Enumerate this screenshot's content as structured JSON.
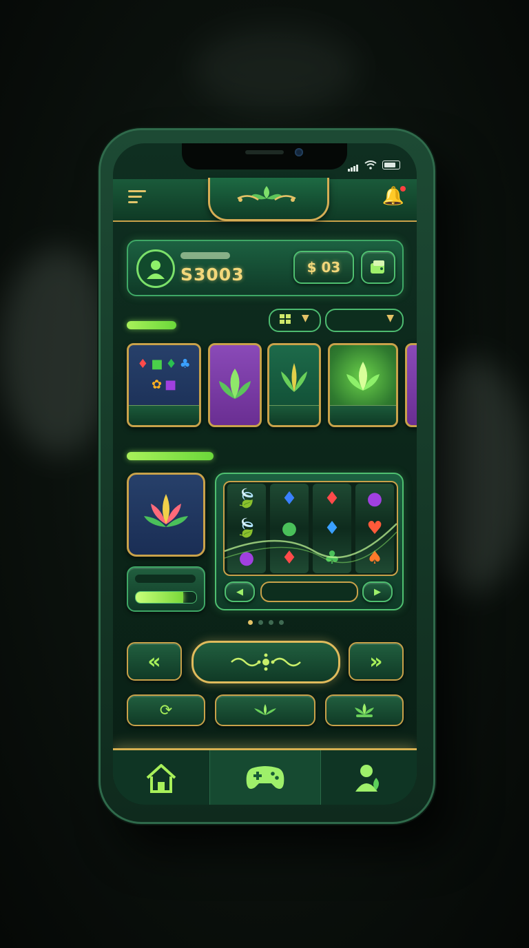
{
  "balance_panel": {
    "amount": "S3003",
    "coins": "$ 03"
  },
  "colors": {
    "accent": "#a8f05a",
    "gold": "#c9a24a",
    "panel": "#1c6141"
  },
  "icons": {
    "menu": "hamburger-icon",
    "bell": "bell-icon",
    "avatar": "user-avatar-icon",
    "wallet": "wallet-icon",
    "grid": "grid-icon",
    "home": "home-icon",
    "games": "gamepad-icon",
    "profile": "profile-icon"
  },
  "featured": {
    "progress": 0.78
  },
  "pagination": {
    "total": 4,
    "active": 0
  },
  "controls": {
    "prev": "«",
    "next": "»"
  }
}
